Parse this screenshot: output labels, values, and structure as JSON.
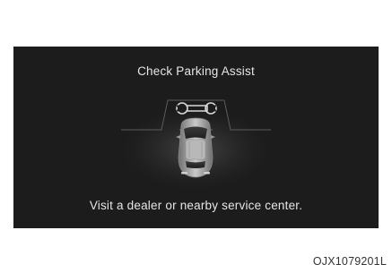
{
  "screen": {
    "title": "Check Parking Assist",
    "message": "Visit a dealer or nearby service center."
  },
  "icons": {
    "warning": "wrench-icon",
    "vehicle": "car-top-view-icon"
  },
  "figure_code": "OJX1079201L",
  "colors": {
    "screen_background": "#1c1c1c",
    "text": "#e6e6e6"
  }
}
